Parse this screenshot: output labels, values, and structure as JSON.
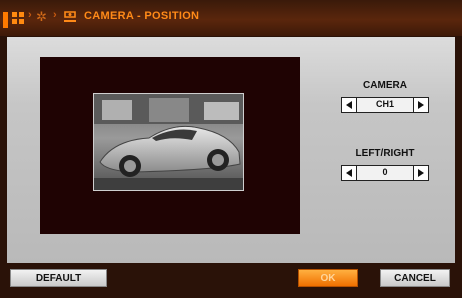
{
  "window": {
    "title": "CAMERA - POSITION",
    "breadcrumb_icons": [
      "menu-grid-icon",
      "gear-icon",
      "camera-icon"
    ]
  },
  "camera": {
    "label": "CAMERA",
    "value": "CH1"
  },
  "left_right": {
    "label": "LEFT/RIGHT",
    "value": "0"
  },
  "buttons": {
    "default": "DEFAULT",
    "ok": "OK",
    "cancel": "CANCEL"
  },
  "colors": {
    "accent": "#ff8a18",
    "titlebar": "#5a260c",
    "panel": "#c6c6c6",
    "preview_bg": "#1f0303"
  }
}
